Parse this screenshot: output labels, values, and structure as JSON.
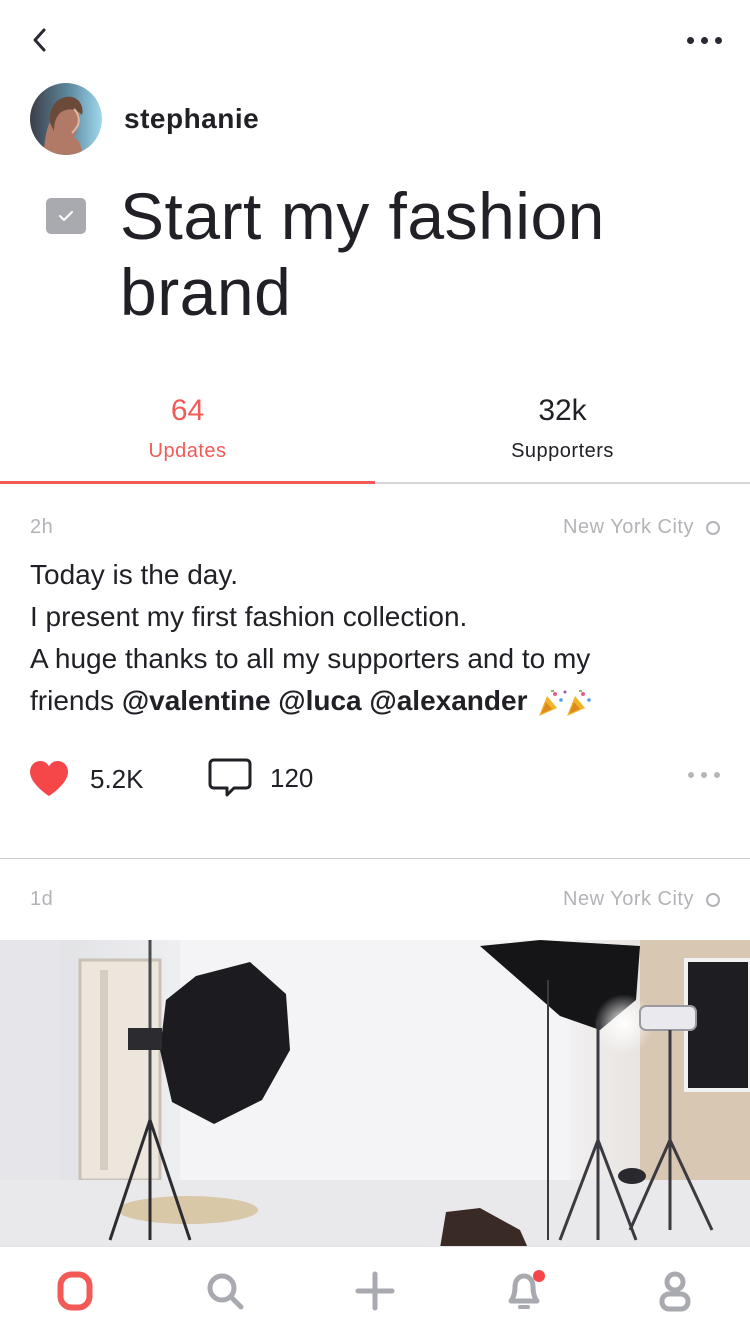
{
  "header": {
    "back_icon": "chevron-left-icon",
    "more_icon": "more-dots-icon"
  },
  "author": {
    "name": "stephanie"
  },
  "goal": {
    "title": "Start my fashion brand",
    "completed": true
  },
  "tabs": [
    {
      "count": "64",
      "label": "Updates",
      "active": true
    },
    {
      "count": "32k",
      "label": "Supporters",
      "active": false
    }
  ],
  "posts": [
    {
      "time": "2h",
      "location": "New York City",
      "lines": [
        "Today is the day.",
        "I present my first fashion collection.",
        "A huge thanks to all my supporters and to my"
      ],
      "last_line_prefix": "friends",
      "mentions": [
        "@valentine",
        "@luca",
        "@alexander"
      ],
      "emoji": "party-popper-icon",
      "likes": "5.2K",
      "comments": "120"
    },
    {
      "time": "1d",
      "location": "New York City",
      "image": "photo-studio-image"
    }
  ],
  "tabbar": [
    {
      "icon": "home-ring-icon",
      "active": true
    },
    {
      "icon": "search-icon",
      "active": false
    },
    {
      "icon": "plus-icon",
      "active": false
    },
    {
      "icon": "bell-icon",
      "active": false,
      "badge": true
    },
    {
      "icon": "profile-icon",
      "active": false
    }
  ],
  "colors": {
    "accent": "#f25a57",
    "text": "#222026",
    "muted": "#b3b3b8",
    "icon": "#a9aab0"
  }
}
